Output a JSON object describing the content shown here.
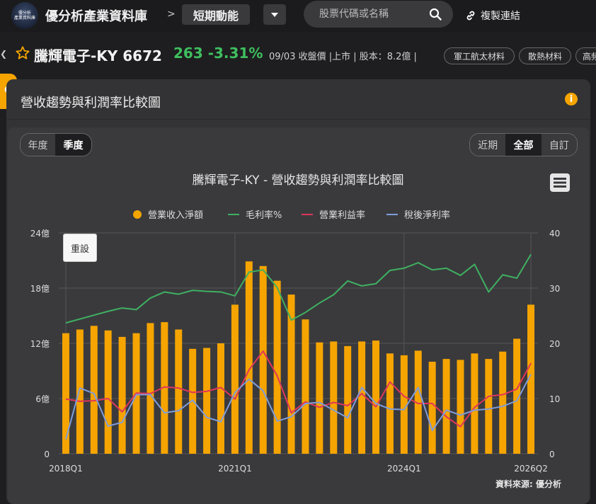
{
  "header": {
    "logo_text_1": "優分析",
    "logo_text_2": "產業資料庫",
    "site_title": "優分析產業資料庫",
    "breadcrumb_sep": ">",
    "breadcrumb_current": "短期動能",
    "search_placeholder": "股票代碼或名稱",
    "copy_link_label": "複製連結"
  },
  "stock": {
    "name": "騰輝電子-KY 6672",
    "price_change": "263 -3.31%",
    "meta": "09/03 收盤價 |上市 | 股本：8.2億 |",
    "tags": [
      "軍工航太材料",
      "散熱材料",
      "高頻"
    ]
  },
  "panel": {
    "title": "營收趨勢與利潤率比較圖",
    "info_icon": "i",
    "period_tabs": [
      {
        "label": "年度",
        "active": false
      },
      {
        "label": "季度",
        "active": true
      }
    ],
    "range_tabs": [
      {
        "label": "近期",
        "active": false
      },
      {
        "label": "全部",
        "active": true
      },
      {
        "label": "自訂",
        "active": false
      }
    ],
    "reset_label": "重設",
    "source": "資料來源: 優分析"
  },
  "colors": {
    "revenue": "#f5a400",
    "gross_margin": "#3fb060",
    "operating_margin": "#e0365a",
    "net_margin": "#7f9ddb",
    "price_green": "#3fbf5f",
    "accent": "#f5a400"
  },
  "chart_data": {
    "type": "bar",
    "title": "騰輝電子-KY - 營收趨勢與利潤率比較圖",
    "x_tick_labels": [
      "2018Q1",
      "2021Q1",
      "2024Q1",
      "2026Q2"
    ],
    "y_left_ticks": [
      "0",
      "6億",
      "12億",
      "18億",
      "24億"
    ],
    "y_right_ticks": [
      "0",
      "10",
      "20",
      "30",
      "40"
    ],
    "ylim_left": [
      0,
      24
    ],
    "ylim_right": [
      0,
      40
    ],
    "legend": [
      "營業收入淨額",
      "毛利率%",
      "營業利益率",
      "稅後淨利率"
    ],
    "legend_position": "top-center",
    "grid": true,
    "categories": [
      "2018Q1",
      "2018Q2",
      "2018Q3",
      "2018Q4",
      "2019Q1",
      "2019Q2",
      "2019Q3",
      "2019Q4",
      "2020Q1",
      "2020Q2",
      "2020Q3",
      "2020Q4",
      "2021Q1",
      "2021Q2",
      "2021Q3",
      "2021Q4",
      "2022Q1",
      "2022Q2",
      "2022Q3",
      "2022Q4",
      "2023Q1",
      "2023Q2",
      "2023Q3",
      "2023Q4",
      "2024Q1",
      "2024Q2",
      "2024Q3",
      "2024Q4",
      "2025Q1",
      "2025Q2",
      "2025Q3",
      "2025Q4",
      "2026Q1",
      "2026Q2"
    ],
    "series": [
      {
        "name": "營業收入淨額",
        "kind": "bar",
        "axis": "left",
        "values": [
          13.1,
          13.5,
          13.9,
          13.4,
          12.7,
          13.1,
          14.2,
          14.3,
          13.5,
          11.4,
          11.5,
          12.0,
          16.2,
          20.9,
          20.4,
          18.8,
          17.3,
          14.6,
          12.1,
          12.2,
          11.7,
          12.2,
          12.3,
          10.9,
          10.7,
          11.2,
          10.0,
          10.3,
          10.2,
          10.9,
          10.3,
          11.1,
          12.5,
          16.2
        ]
      },
      {
        "name": "毛利率%",
        "kind": "line",
        "axis": "right",
        "values": [
          23.7,
          24.4,
          25.1,
          25.8,
          26.4,
          26.1,
          28.2,
          29.3,
          28.9,
          29.6,
          29.4,
          29.3,
          28.6,
          32.9,
          33.3,
          30.1,
          24.2,
          25.6,
          27.3,
          28.8,
          31.3,
          30.4,
          30.8,
          33.2,
          33.6,
          34.6,
          33.3,
          33.6,
          32.3,
          34.3,
          29.3,
          32.4,
          31.8,
          36.1
        ]
      },
      {
        "name": "營業利益率",
        "kind": "line",
        "axis": "right",
        "values": [
          9.9,
          9.5,
          9.6,
          10.0,
          7.6,
          11.0,
          10.9,
          12.1,
          11.9,
          11.1,
          11.3,
          12.0,
          9.9,
          15.2,
          18.6,
          14.1,
          7.4,
          9.4,
          8.4,
          9.3,
          8.7,
          10.9,
          8.5,
          13.0,
          10.4,
          9.1,
          9.1,
          6.7,
          4.9,
          8.4,
          10.4,
          10.7,
          11.7,
          16.4
        ]
      },
      {
        "name": "稅後淨利率",
        "kind": "line",
        "axis": "right",
        "values": [
          2.6,
          11.9,
          10.9,
          5.0,
          5.7,
          10.7,
          10.7,
          7.4,
          7.8,
          9.7,
          6.6,
          5.8,
          11.1,
          13.5,
          11.4,
          5.9,
          6.7,
          9.1,
          9.3,
          7.9,
          6.5,
          12.0,
          9.1,
          8.1,
          8.0,
          12.0,
          4.2,
          7.9,
          7.0,
          7.9,
          8.1,
          8.6,
          9.6,
          14.4
        ]
      }
    ]
  }
}
